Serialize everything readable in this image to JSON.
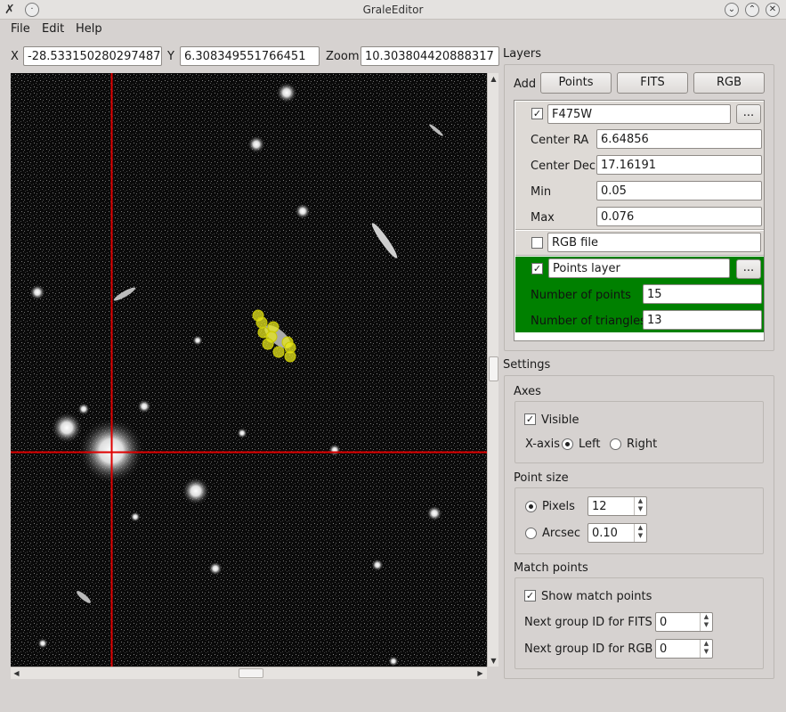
{
  "window": {
    "title": "GraleEditor"
  },
  "menu": {
    "file": "File",
    "edit": "Edit",
    "help": "Help"
  },
  "coords": {
    "x_label": "X",
    "x_value": "-28.533150280297487",
    "y_label": "Y",
    "y_value": "6.308349551766451",
    "zoom_label": "Zoom",
    "zoom_value": "10.303804420888317"
  },
  "layers": {
    "title": "Layers",
    "add_label": "Add",
    "btn_points": "Points",
    "btn_fits": "FITS",
    "btn_rgb": "RGB",
    "fits_layer": {
      "name": "F475W",
      "checked": true,
      "browse": "...",
      "center_ra_label": "Center RA",
      "center_ra": "6.64856",
      "center_dec_label": "Center Dec",
      "center_dec": "17.16191",
      "min_label": "Min",
      "min": "0.05",
      "max_label": "Max",
      "max": "0.076"
    },
    "rgb_layer": {
      "name": "RGB file",
      "checked": false
    },
    "points_layer": {
      "name": "Points layer",
      "checked": true,
      "browse": "...",
      "num_points_label": "Number of points",
      "num_points": "15",
      "num_triangles_label": "Number of triangles",
      "num_triangles": "13",
      "bg_color": "#008000"
    }
  },
  "settings": {
    "title": "Settings",
    "axes": {
      "title": "Axes",
      "visible_label": "Visible",
      "xaxis_label": "X-axis",
      "left_label": "Left",
      "right_label": "Right",
      "selected": "Left"
    },
    "point_size": {
      "title": "Point size",
      "pixels_label": "Pixels",
      "pixels_value": "12",
      "arcsec_label": "Arcsec",
      "arcsec_value": "0.10",
      "selected": "Pixels"
    },
    "match_points": {
      "title": "Match points",
      "show_label": "Show match points",
      "fits_label": "Next group ID for FITS",
      "fits_value": "0",
      "rgb_label": "Next group ID for RGB",
      "rgb_value": "0"
    }
  },
  "colors": {
    "crosshair": "#e00000",
    "points": "#e6e61e",
    "background": "#d6d2d0"
  }
}
